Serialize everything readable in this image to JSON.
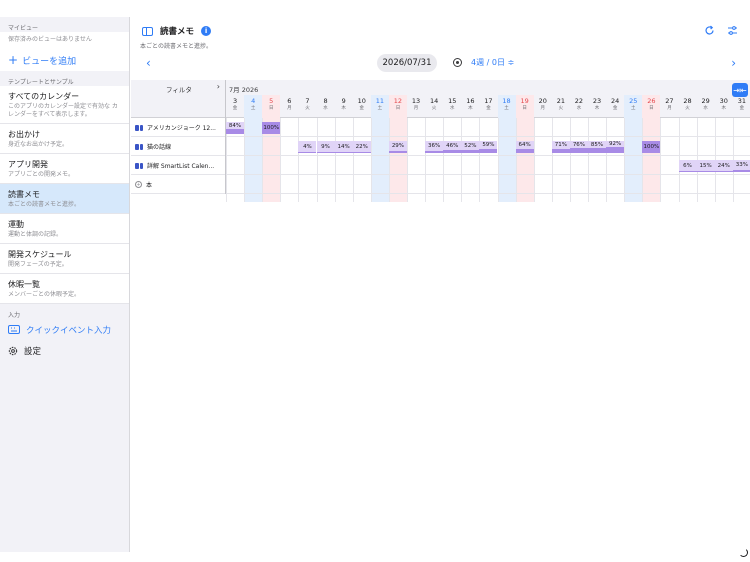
{
  "sidebar": {
    "my_views_header": "マイビュー",
    "no_saved_views": "保存済みのビューはありません",
    "add_view_label": "ビューを追加",
    "templates_header": "テンプレートとサンプル",
    "items": [
      {
        "title": "すべてのカレンダー",
        "subtitle": "このアプリのカレンダー設定で有効な カレンダーをすべて表示します。"
      },
      {
        "title": "お出かけ",
        "subtitle": "身近なお出かけ予定。"
      },
      {
        "title": "アプリ開発",
        "subtitle": "アプリごとの開発メモ。"
      },
      {
        "title": "読書メモ",
        "subtitle": "本ごとの読書メモと進捗。",
        "active": true
      },
      {
        "title": "運動",
        "subtitle": "運動と体調の記録。"
      },
      {
        "title": "開発スケジュール",
        "subtitle": "開発フェーズの予定。"
      },
      {
        "title": "休暇一覧",
        "subtitle": "メンバーごとの休暇予定。"
      }
    ],
    "input_header": "入力",
    "quick_event_label": "クイックイベント入力",
    "settings_label": "設定"
  },
  "header": {
    "title": "読書メモ",
    "subtitle": "本ごとの読書メモと進捗。",
    "current_date": "2026/07/31",
    "span_label": "4週 / 0日 ≑"
  },
  "grid": {
    "filter_label": "フィルタ",
    "month_label": "7月 2026",
    "days": [
      {
        "d": "3",
        "w": "金",
        "t": "n"
      },
      {
        "d": "4",
        "w": "土",
        "t": "sat"
      },
      {
        "d": "5",
        "w": "日",
        "t": "sun"
      },
      {
        "d": "6",
        "w": "月",
        "t": "n"
      },
      {
        "d": "7",
        "w": "火",
        "t": "n"
      },
      {
        "d": "8",
        "w": "水",
        "t": "n"
      },
      {
        "d": "9",
        "w": "木",
        "t": "n"
      },
      {
        "d": "10",
        "w": "金",
        "t": "n"
      },
      {
        "d": "11",
        "w": "土",
        "t": "sat"
      },
      {
        "d": "12",
        "w": "日",
        "t": "sun"
      },
      {
        "d": "13",
        "w": "月",
        "t": "n"
      },
      {
        "d": "14",
        "w": "火",
        "t": "n"
      },
      {
        "d": "15",
        "w": "水",
        "t": "n"
      },
      {
        "d": "16",
        "w": "木",
        "t": "n"
      },
      {
        "d": "17",
        "w": "金",
        "t": "n"
      },
      {
        "d": "18",
        "w": "土",
        "t": "sat"
      },
      {
        "d": "19",
        "w": "日",
        "t": "sun"
      },
      {
        "d": "20",
        "w": "月",
        "t": "n"
      },
      {
        "d": "21",
        "w": "火",
        "t": "n"
      },
      {
        "d": "22",
        "w": "水",
        "t": "n"
      },
      {
        "d": "23",
        "w": "木",
        "t": "n"
      },
      {
        "d": "24",
        "w": "金",
        "t": "n"
      },
      {
        "d": "25",
        "w": "土",
        "t": "sat"
      },
      {
        "d": "26",
        "w": "日",
        "t": "sun"
      },
      {
        "d": "27",
        "w": "月",
        "t": "n"
      },
      {
        "d": "28",
        "w": "火",
        "t": "n"
      },
      {
        "d": "29",
        "w": "水",
        "t": "n"
      },
      {
        "d": "30",
        "w": "木",
        "t": "n"
      },
      {
        "d": "31",
        "w": "金",
        "t": "n"
      }
    ],
    "rows": [
      {
        "label": "アメリカンジョーク 12...",
        "icon": "book-icon",
        "cells": [
          {
            "day": 0,
            "text": "84%",
            "pct": 84
          },
          {
            "day": 2,
            "text": "100%",
            "pct": 100
          }
        ]
      },
      {
        "label": "猫の話線",
        "icon": "book-icon",
        "cells": [
          {
            "day": 4,
            "text": "4%",
            "pct": 4
          },
          {
            "day": 5,
            "text": "9%",
            "pct": 9
          },
          {
            "day": 6,
            "text": "14%",
            "pct": 14
          },
          {
            "day": 7,
            "text": "22%",
            "pct": 22
          },
          {
            "day": 9,
            "text": "29%",
            "pct": 29
          },
          {
            "day": 11,
            "text": "36%",
            "pct": 36
          },
          {
            "day": 12,
            "text": "46%",
            "pct": 46
          },
          {
            "day": 13,
            "text": "52%",
            "pct": 52
          },
          {
            "day": 14,
            "text": "59%",
            "pct": 59
          },
          {
            "day": 16,
            "text": "64%",
            "pct": 64
          },
          {
            "day": 18,
            "text": "71%",
            "pct": 71
          },
          {
            "day": 19,
            "text": "76%",
            "pct": 76
          },
          {
            "day": 20,
            "text": "85%",
            "pct": 85
          },
          {
            "day": 21,
            "text": "92%",
            "pct": 92
          },
          {
            "day": 23,
            "text": "100%",
            "pct": 100
          }
        ]
      },
      {
        "label": "詳解 SmartList Calen...",
        "icon": "book-icon",
        "cells": [
          {
            "day": 25,
            "text": "6%",
            "pct": 6
          },
          {
            "day": 26,
            "text": "15%",
            "pct": 15
          },
          {
            "day": 27,
            "text": "24%",
            "pct": 24
          },
          {
            "day": 28,
            "text": "33%",
            "pct": 33
          }
        ]
      },
      {
        "label": "本",
        "icon": "add-circle-icon",
        "cells": []
      }
    ]
  },
  "colors": {
    "accent": "#2f7cf6",
    "saturday_bg": "#e3eefc",
    "sunday_bg": "#fde8ea",
    "saturday_text": "#2f7cf6",
    "sunday_text": "#e5484d",
    "progress_fill": "#e0d4f7",
    "progress_bar": "#a88be6"
  }
}
